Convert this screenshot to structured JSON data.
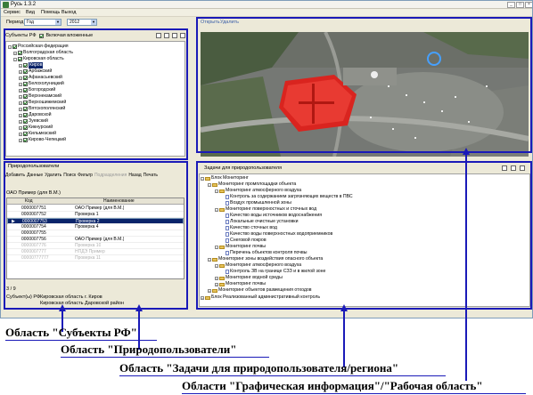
{
  "window": {
    "title": "Русь 1.3.2",
    "menu": [
      "Сервис",
      "Вид",
      "Помощь",
      "Выход"
    ]
  },
  "period": {
    "label": "Период",
    "type_value": "Год",
    "year_value": "2012"
  },
  "subjects_panel": {
    "header": "Субъекты РФ",
    "include_nested_label": "Включая вложенные",
    "tree": [
      {
        "label": "Российская федерация",
        "level": 0
      },
      {
        "label": "Волгоградская область",
        "level": 1
      },
      {
        "label": "Кировская область",
        "level": 1
      },
      {
        "label": "Киров",
        "level": 2,
        "selected": true
      },
      {
        "label": "Арбажский",
        "level": 2
      },
      {
        "label": "Афанасьевский",
        "level": 2
      },
      {
        "label": "Белохолуницкий",
        "level": 2
      },
      {
        "label": "Богородский",
        "level": 2
      },
      {
        "label": "Верхнекамский",
        "level": 2
      },
      {
        "label": "Верхошижемский",
        "level": 2
      },
      {
        "label": "Вятскополянский",
        "level": 2
      },
      {
        "label": "Даровской",
        "level": 2
      },
      {
        "label": "Зуевский",
        "level": 2
      },
      {
        "label": "Кикнурский",
        "level": 2
      },
      {
        "label": "Кильмезский",
        "level": 2
      },
      {
        "label": "Кирово-Чепецкий",
        "level": 2
      }
    ]
  },
  "nature_users_panel": {
    "header": "Природопользователи",
    "toolbar": [
      "Добавить",
      "Данные",
      "Удалить",
      "Поиск",
      "Фильтр",
      "Подразделения",
      "Назад",
      "Печать"
    ],
    "subheader": "ОАО Пример (для В.М.)",
    "columns": [
      "Код",
      "Наименование"
    ],
    "rows": [
      {
        "code": "0000007751",
        "name": "ОАО Пример (для В.М.)",
        "state": "normal"
      },
      {
        "code": "0000007752",
        "name": "Проверка 1",
        "state": "normal"
      },
      {
        "code": "0000007753",
        "name": "Проверка 2",
        "state": "selected"
      },
      {
        "code": "0000007754",
        "name": "Проверка 4",
        "state": "normal"
      },
      {
        "code": "0000007755",
        "name": "",
        "state": "normal"
      },
      {
        "code": "0000007756",
        "name": "ОАО Пример (для В.М.)",
        "state": "normal"
      },
      {
        "code": "0000007776",
        "name": "Проверка 10",
        "state": "dim"
      },
      {
        "code": "0000007777",
        "name": "НПДЭ Пример",
        "state": "dim"
      },
      {
        "code": "00000777777",
        "name": "Проверка 11",
        "state": "dim"
      }
    ],
    "pager": "3 / 9",
    "status_left": "Субъект(ы) РФ",
    "status_right": "Кировская область г. Киров",
    "status_right2": "Кировская область Даровской район"
  },
  "graphics_panel": {
    "tabs": [
      "Открыть",
      "Удалить"
    ]
  },
  "tasks_panel": {
    "header": "Задачи для природопользователя",
    "tree": [
      {
        "label": "Блок Мониторинг",
        "level": 0,
        "kind": "folder"
      },
      {
        "label": "Мониторинг промплощадки объекта",
        "level": 1,
        "kind": "folder"
      },
      {
        "label": "Мониторинг атмосферного воздуха",
        "level": 2,
        "kind": "folder"
      },
      {
        "label": "Контроль за содержанием загрязняющих веществ в ПВС",
        "level": 3,
        "kind": "doc"
      },
      {
        "label": "Воздух промышленной зоны",
        "level": 3,
        "kind": "doc"
      },
      {
        "label": "Мониторинг поверхностных и сточных вод",
        "level": 2,
        "kind": "folder"
      },
      {
        "label": "Качество воды источников водоснабжения",
        "level": 3,
        "kind": "doc"
      },
      {
        "label": "Локальные очистные установки",
        "level": 3,
        "kind": "doc"
      },
      {
        "label": "Качество сточных вод",
        "level": 3,
        "kind": "doc"
      },
      {
        "label": "Качество воды поверхностных водоприемников",
        "level": 3,
        "kind": "doc"
      },
      {
        "label": "Снеговой покров",
        "level": 3,
        "kind": "doc"
      },
      {
        "label": "Мониторинг почвы",
        "level": 2,
        "kind": "folder"
      },
      {
        "label": "Перечень объектов контроля почвы",
        "level": 3,
        "kind": "doc"
      },
      {
        "label": "Мониторинг зоны воздействия опасного объекта",
        "level": 1,
        "kind": "folder"
      },
      {
        "label": "Мониторинг атмосферного воздуха",
        "level": 2,
        "kind": "folder"
      },
      {
        "label": "Контроль ЗВ на границе СЗЗ и в жилой зоне",
        "level": 3,
        "kind": "doc"
      },
      {
        "label": "Мониторинг водной среды",
        "level": 2,
        "kind": "folder"
      },
      {
        "label": "Мониторинг почвы",
        "level": 2,
        "kind": "folder"
      },
      {
        "label": "Мониторинг объектов размещения отходов",
        "level": 1,
        "kind": "folder"
      },
      {
        "label": "Блок Реализованный  административный контроль",
        "level": 0,
        "kind": "folder"
      }
    ]
  },
  "captions": {
    "subjects": "Область \"Субъекты РФ\"",
    "nature_users": "Область \"Природопользователи\"",
    "tasks": "Область \"Задачи для природопользователя/региона\"",
    "graphics": "Области \"Графическая информация\"/\"Рабочая область\""
  },
  "colors": {
    "accent_frame": "#1a1ab8",
    "selection": "#0a246a",
    "roof": "#e0221f"
  }
}
